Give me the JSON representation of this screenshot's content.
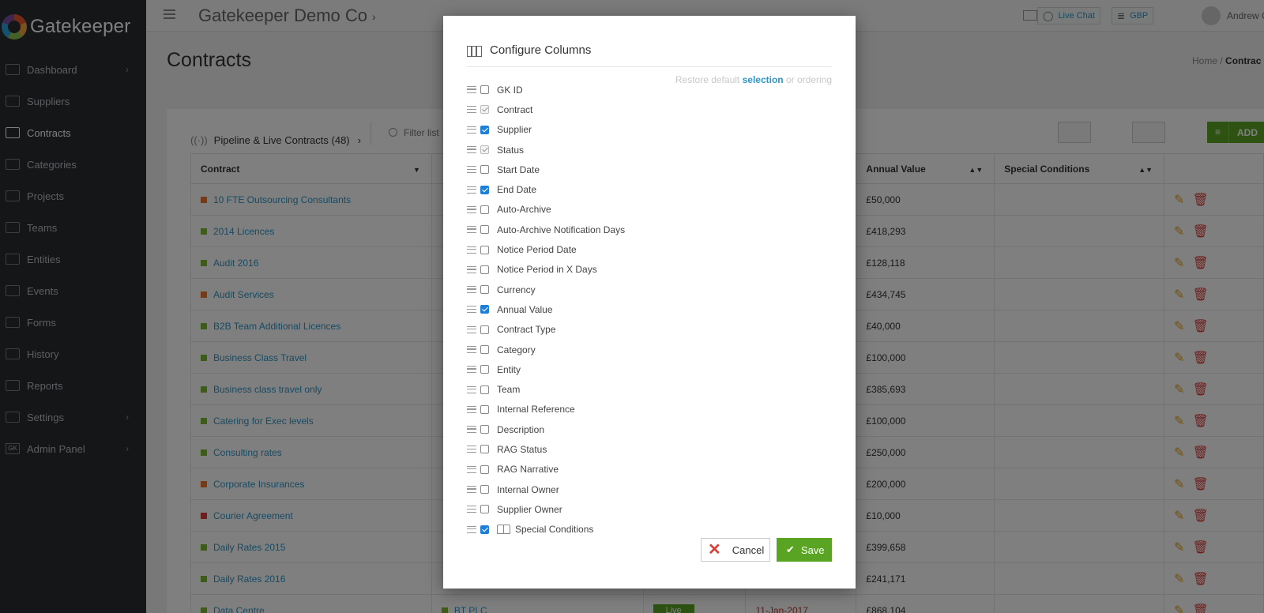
{
  "app": {
    "name": "Gatekeeper"
  },
  "sidebar": {
    "items": [
      {
        "label": "Dashboard",
        "icon": "monitor-icon",
        "has_chevron": true
      },
      {
        "label": "Suppliers",
        "icon": "briefcase-icon",
        "has_chevron": false
      },
      {
        "label": "Contracts",
        "icon": "document-icon",
        "has_chevron": false,
        "active": true
      },
      {
        "label": "Categories",
        "icon": "folder-icon",
        "has_chevron": false
      },
      {
        "label": "Projects",
        "icon": "edit-icon",
        "has_chevron": false
      },
      {
        "label": "Teams",
        "icon": "people-icon",
        "has_chevron": false
      },
      {
        "label": "Entities",
        "icon": "building-icon",
        "has_chevron": false
      },
      {
        "label": "Events",
        "icon": "flag-icon",
        "has_chevron": false
      },
      {
        "label": "Forms",
        "icon": "clipboard-icon",
        "has_chevron": false
      },
      {
        "label": "History",
        "icon": "clock-icon",
        "has_chevron": false
      },
      {
        "label": "Reports",
        "icon": "bar-chart-icon",
        "has_chevron": false
      },
      {
        "label": "Settings",
        "icon": "gear-icon",
        "has_chevron": true
      },
      {
        "label": "Admin Panel",
        "icon": "gk-badge-icon",
        "badge": "GK",
        "has_chevron": true
      }
    ]
  },
  "topbar": {
    "company": "Gatekeeper Demo Co",
    "live_chat": "Live Chat",
    "currency": "GBP",
    "user": "Andrew C"
  },
  "page": {
    "title": "Contracts",
    "breadcrumb_home": "Home",
    "breadcrumb_sep": "/",
    "breadcrumb_current": "Contrac"
  },
  "toolbar": {
    "view_label": "Pipeline & Live Contracts (48)",
    "filter_placeholder": "Filter list",
    "add_label": "ADD"
  },
  "table": {
    "headers": {
      "contract": "Contract",
      "annual_value": "Annual Value",
      "special_conditions": "Special Conditions"
    },
    "rows": [
      {
        "name": "10 FTE Outsourcing Consultants",
        "color": "#e8762d",
        "value": "£50,000"
      },
      {
        "name": "2014 Licences",
        "color": "#7ab830",
        "value": "£418,293"
      },
      {
        "name": "Audit 2016",
        "color": "#7ab830",
        "value": "£128,118"
      },
      {
        "name": "Audit Services",
        "color": "#e8762d",
        "value": "£434,745"
      },
      {
        "name": "B2B Team Additional Licences",
        "color": "#7ab830",
        "value": "£40,000"
      },
      {
        "name": "Business Class Travel",
        "color": "#7ab830",
        "value": "£100,000"
      },
      {
        "name": "Business class travel only",
        "color": "#7ab830",
        "value": "£385,693"
      },
      {
        "name": "Catering for Exec levels",
        "color": "#7ab830",
        "value": "£100,000"
      },
      {
        "name": "Consulting rates",
        "color": "#7ab830",
        "value": "£250,000"
      },
      {
        "name": "Corporate Insurances",
        "color": "#e8762d",
        "value": "£200,000"
      },
      {
        "name": "Courier Agreement",
        "color": "#d9403a",
        "value": "£10,000"
      },
      {
        "name": "Daily Rates 2015",
        "color": "#7ab830",
        "value": "£399,658"
      },
      {
        "name": "Daily Rates 2016",
        "color": "#7ab830",
        "value": "£241,171"
      },
      {
        "name": "Data Centre",
        "color": "#7ab830",
        "value": "£868,104",
        "supplier": "BT PLC",
        "status": "Live",
        "end_date": "11-Jan-2017"
      }
    ]
  },
  "modal": {
    "title": "Configure Columns",
    "restore_prefix": "Restore default",
    "restore_selection": "selection",
    "restore_suffix": "or ordering",
    "columns": [
      {
        "label": "GK ID",
        "state": "unchecked"
      },
      {
        "label": "Contract",
        "state": "locked"
      },
      {
        "label": "Supplier",
        "state": "checked"
      },
      {
        "label": "Status",
        "state": "locked"
      },
      {
        "label": "Start Date",
        "state": "unchecked"
      },
      {
        "label": "End Date",
        "state": "checked"
      },
      {
        "label": "Auto-Archive",
        "state": "unchecked"
      },
      {
        "label": "Auto-Archive Notification Days",
        "state": "unchecked"
      },
      {
        "label": "Notice Period Date",
        "state": "unchecked"
      },
      {
        "label": "Notice Period in X Days",
        "state": "unchecked"
      },
      {
        "label": "Currency",
        "state": "unchecked"
      },
      {
        "label": "Annual Value",
        "state": "checked"
      },
      {
        "label": "Contract Type",
        "state": "unchecked"
      },
      {
        "label": "Category",
        "state": "unchecked"
      },
      {
        "label": "Entity",
        "state": "unchecked"
      },
      {
        "label": "Team",
        "state": "unchecked"
      },
      {
        "label": "Internal Reference",
        "state": "unchecked"
      },
      {
        "label": "Description",
        "state": "unchecked"
      },
      {
        "label": "RAG Status",
        "state": "unchecked"
      },
      {
        "label": "RAG Narrative",
        "state": "unchecked"
      },
      {
        "label": "Internal Owner",
        "state": "unchecked"
      },
      {
        "label": "Supplier Owner",
        "state": "unchecked"
      },
      {
        "label": "Special Conditions",
        "state": "checked",
        "icon": "book-icon"
      }
    ],
    "cancel_label": "Cancel",
    "save_label": "Save"
  }
}
